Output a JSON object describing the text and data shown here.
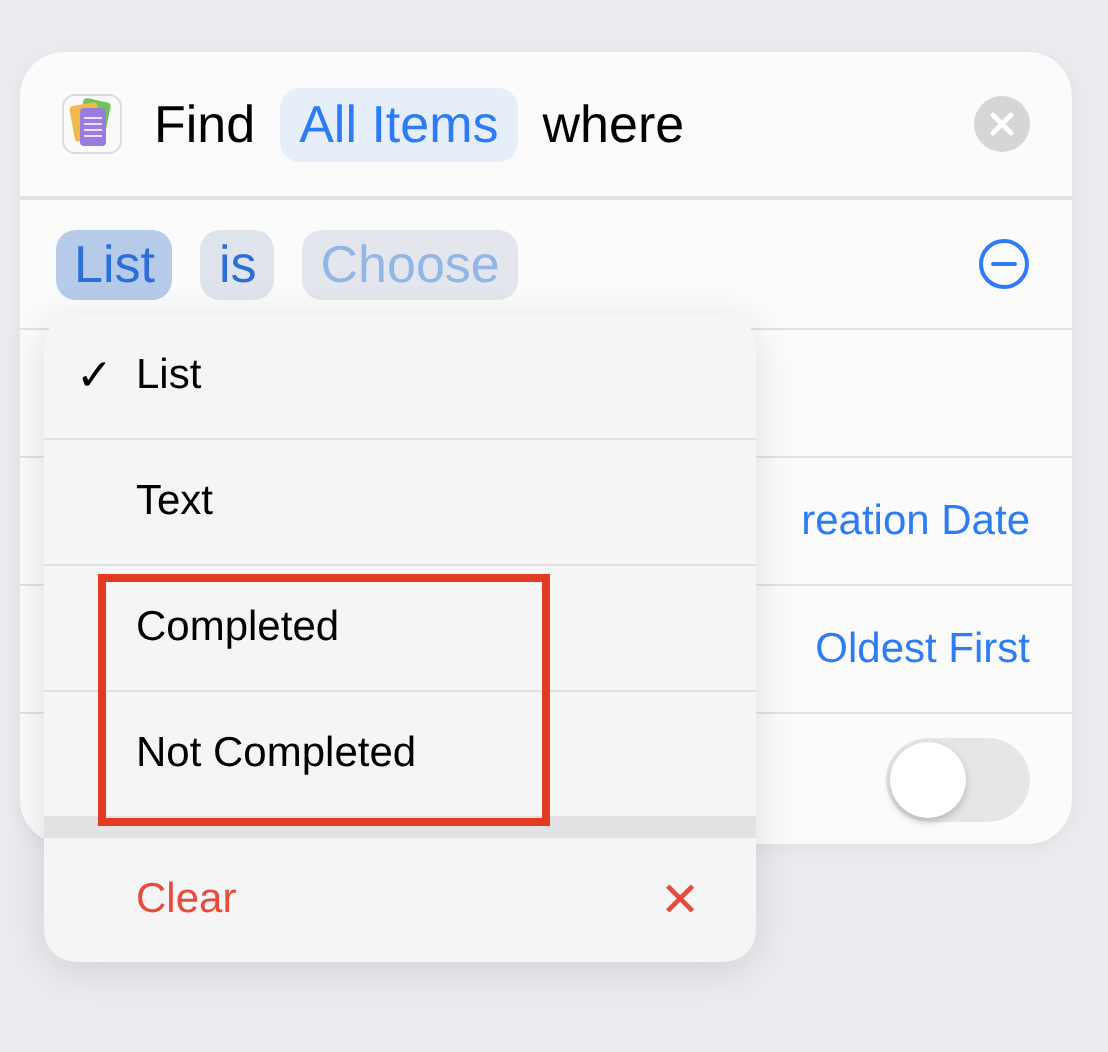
{
  "action": {
    "verb": "Find",
    "subject": "All Items",
    "connector": "where"
  },
  "filter": {
    "property": {
      "label": "List",
      "selected": true
    },
    "operator": "is",
    "value": {
      "placeholder": "Choose"
    }
  },
  "rows": [
    {
      "kind": "empty"
    },
    {
      "kind": "link",
      "value": "reation Date"
    },
    {
      "kind": "link",
      "value": "Oldest First"
    },
    {
      "kind": "toggle",
      "on": false
    }
  ],
  "menu": {
    "items": [
      {
        "label": "List",
        "checked": true,
        "highlighted": false
      },
      {
        "label": "Text",
        "checked": false,
        "highlighted": false
      },
      {
        "label": "Completed",
        "checked": false,
        "highlighted": true
      },
      {
        "label": "Not Completed",
        "checked": false,
        "highlighted": true
      }
    ],
    "check_mark": "✓",
    "clear": {
      "label": "Clear",
      "icon": "✕"
    }
  }
}
